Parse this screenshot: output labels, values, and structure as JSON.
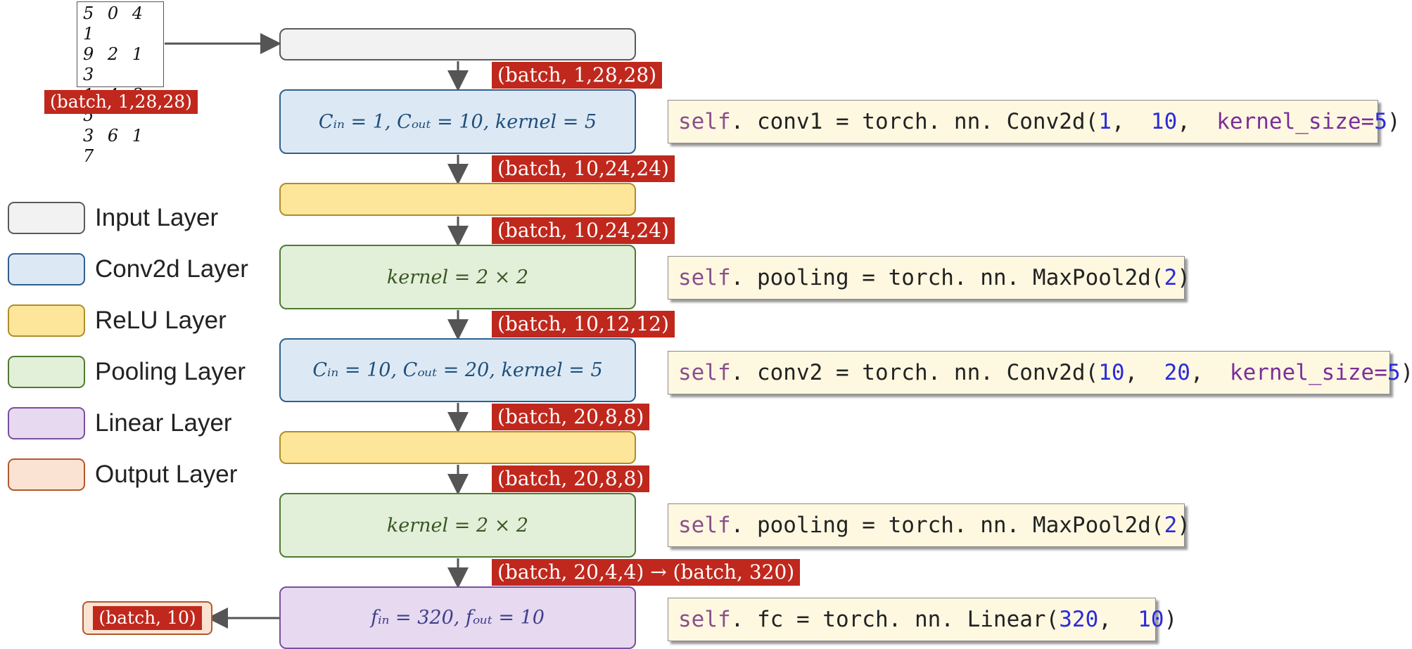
{
  "input_image": {
    "rows": [
      "5 0 4 1",
      "9 2 1 3",
      "1 4 3 5",
      "3 6 1 7"
    ]
  },
  "legend": [
    {
      "label": "Input Layer",
      "color": "#f2f2f2"
    },
    {
      "label": "Conv2d Layer",
      "color": "#dce9f5"
    },
    {
      "label": "ReLU Layer",
      "color": "#fde59a"
    },
    {
      "label": "Pooling Layer",
      "color": "#e2efd9"
    },
    {
      "label": "Linear Layer",
      "color": "#e6d9f0"
    },
    {
      "label": "Output Layer",
      "color": "#fbe3d3"
    }
  ],
  "layers": {
    "conv1": "Cᵢₙ = 1, Cₒᵤₜ = 10, kernel = 5",
    "pool1": "kernel = 2 × 2",
    "conv2": "Cᵢₙ = 10, Cₒᵤₜ = 20, kernel = 5",
    "pool2": "kernel = 2 × 2",
    "fc": "fᵢₙ = 320, fₒᵤₜ = 10"
  },
  "shapes": {
    "input": "(batch, 1,28,28)",
    "after_input": "(batch, 1,28,28)",
    "after_conv1": "(batch, 10,24,24)",
    "after_relu1": "(batch, 10,24,24)",
    "after_pool1": "(batch, 10,12,12)",
    "after_conv2": "(batch, 20,8,8)",
    "after_relu2": "(batch, 20,8,8)",
    "after_pool2": "(batch, 20,4,4) → (batch, 320)",
    "output": "(batch, 10)"
  },
  "code": {
    "conv1": {
      "self": "self",
      "rest": ". conv1 = torch. nn. Conv2d(",
      "a1": "1",
      "sep1": ",  ",
      "a2": "10",
      "sep2": ",  ",
      "kw": "kernel_size=",
      "a3": "5",
      "end": ")"
    },
    "pool1": {
      "self": "self",
      "rest": ". pooling = torch. nn. MaxPool2d(",
      "a1": "2",
      "end": ")"
    },
    "conv2": {
      "self": "self",
      "rest": ". conv2 = torch. nn. Conv2d(",
      "a1": "10",
      "sep1": ",  ",
      "a2": "20",
      "sep2": ",  ",
      "kw": "kernel_size=",
      "a3": "5",
      "end": ")"
    },
    "pool2": {
      "self": "self",
      "rest": ". pooling = torch. nn. MaxPool2d(",
      "a1": "2",
      "end": ")"
    },
    "fc": {
      "self": "self",
      "rest": ". fc = torch. nn. Linear(",
      "a1": "320",
      "sep1": ",  ",
      "a2": "10",
      "end": ")"
    }
  }
}
